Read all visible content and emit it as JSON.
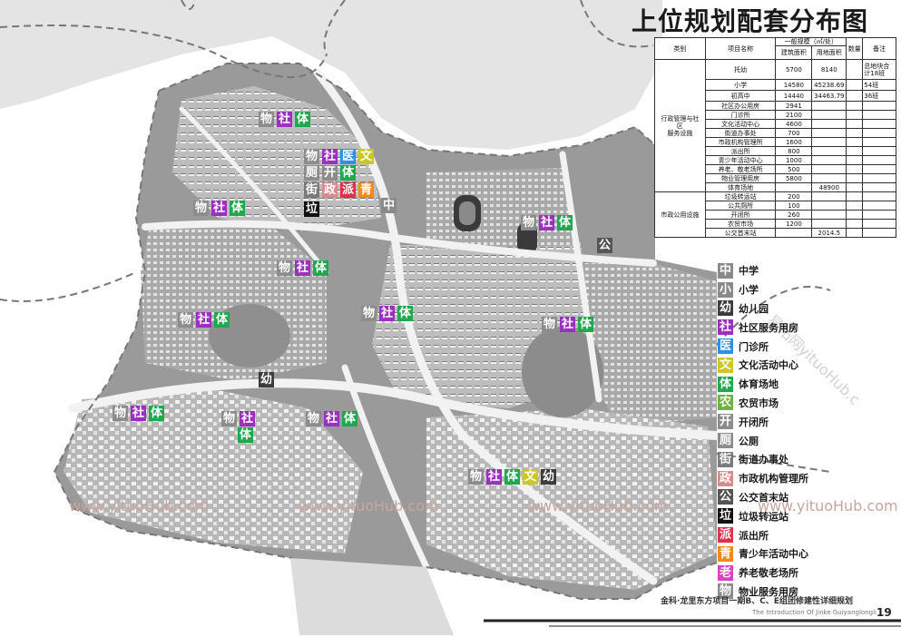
{
  "title": "上位规划配套分布图",
  "table": {
    "header": {
      "category": "类别",
      "item": "项目名称",
      "scale_group": "一般规模（㎡/处）",
      "build_area": "建筑面积",
      "land_area": "用地面积",
      "quantity": "数量",
      "note": "备注"
    },
    "groups": [
      {
        "name_lines": [
          "行政管理与社",
          "区",
          "服务设施"
        ]
      },
      {
        "name_lines": [
          "市政公用设施"
        ]
      }
    ],
    "rows": [
      {
        "name": "托幼",
        "build": "5700",
        "land": "8140",
        "qty": "",
        "note": "总地块合计18班"
      },
      {
        "name": "小学",
        "build": "14580",
        "land": "45238.69",
        "qty": "",
        "note": "54班"
      },
      {
        "name": "初高中",
        "build": "14440",
        "land": "34463.79",
        "qty": "",
        "note": "36班"
      },
      {
        "name": "社区办公用房",
        "build": "2941",
        "land": "",
        "qty": "",
        "note": ""
      },
      {
        "name": "门诊所",
        "build": "2100",
        "land": "",
        "qty": "",
        "note": ""
      },
      {
        "name": "文化活动中心",
        "build": "4600",
        "land": "",
        "qty": "",
        "note": ""
      },
      {
        "name": "街道办事处",
        "build": "700",
        "land": "",
        "qty": "",
        "note": ""
      },
      {
        "name": "市政机构管理所",
        "build": "1600",
        "land": "",
        "qty": "",
        "note": ""
      },
      {
        "name": "派出所",
        "build": "800",
        "land": "",
        "qty": "",
        "note": ""
      },
      {
        "name": "青少年活动中心",
        "build": "1000",
        "land": "",
        "qty": "",
        "note": ""
      },
      {
        "name": "养老、敬老场所",
        "build": "500",
        "land": "",
        "qty": "",
        "note": ""
      },
      {
        "name": "物业管理用房",
        "build": "5800",
        "land": "",
        "qty": "",
        "note": ""
      },
      {
        "name": "体育场地",
        "build": "",
        "land": "48900",
        "qty": "",
        "note": ""
      },
      {
        "name": "垃圾转运站",
        "build": "200",
        "land": "",
        "qty": "",
        "note": ""
      },
      {
        "name": "公共厕所",
        "build": "100",
        "land": "",
        "qty": "",
        "note": ""
      },
      {
        "name": "开闭所",
        "build": "260",
        "land": "",
        "qty": "",
        "note": ""
      },
      {
        "name": "农贸市场",
        "build": "1200",
        "land": "",
        "qty": "",
        "note": ""
      },
      {
        "name": "公交首末站",
        "build": "",
        "land": "2014.5",
        "qty": "",
        "note": ""
      }
    ]
  },
  "legend": [
    {
      "char": "中",
      "label": "中学",
      "color": "#8a8a8a"
    },
    {
      "char": "小",
      "label": "小学",
      "color": "#8a8a8a"
    },
    {
      "char": "幼",
      "label": "幼儿园",
      "color": "#3c3c3c"
    },
    {
      "char": "社",
      "label": "社区服务用房",
      "color": "#9b2fc0"
    },
    {
      "char": "医",
      "label": "门诊所",
      "color": "#2f8fe0"
    },
    {
      "char": "文",
      "label": "文化活动中心",
      "color": "#c9c91f"
    },
    {
      "char": "体",
      "label": "体育场地",
      "color": "#1fa84d"
    },
    {
      "char": "农",
      "label": "农贸市场",
      "color": "#6db33f"
    },
    {
      "char": "开",
      "label": "开闭所",
      "color": "#8c8c8c"
    },
    {
      "char": "厕",
      "label": "公厕",
      "color": "#8c8c8c"
    },
    {
      "char": "街",
      "label": "街道办事处",
      "color": "#7a7a7a"
    },
    {
      "char": "政",
      "label": "市政机构管理所",
      "color": "#d98a8a"
    },
    {
      "char": "公",
      "label": "公交首末站",
      "color": "#555555"
    },
    {
      "char": "垃",
      "label": "垃圾转运站",
      "color": "#111111"
    },
    {
      "char": "派",
      "label": "派出所",
      "color": "#e0304a"
    },
    {
      "char": "青",
      "label": "青少年活动中心",
      "color": "#f08a1a"
    },
    {
      "char": "老",
      "label": "养老敬老场所",
      "color": "#e040c0"
    },
    {
      "char": "物",
      "label": "物业服务用房",
      "color": "#8c8c8c"
    }
  ],
  "map_labels": [
    {
      "group": "物社体",
      "chars": [
        "物",
        "社",
        "体"
      ]
    },
    {
      "group": "物社医文",
      "chars": [
        "物",
        "社",
        "医",
        "文"
      ]
    },
    {
      "group": "厕开体",
      "chars": [
        "厕",
        "开",
        "体"
      ]
    },
    {
      "group": "街政派青",
      "chars": [
        "街",
        "政",
        "派",
        "青"
      ]
    },
    {
      "group": "物社体",
      "chars": [
        "物",
        "社",
        "体"
      ]
    },
    {
      "group": "垃",
      "chars": [
        "垃"
      ]
    },
    {
      "group": "中",
      "chars": [
        "中"
      ]
    },
    {
      "group": "物社体",
      "chars": [
        "物",
        "社",
        "体"
      ]
    },
    {
      "group": "公",
      "chars": [
        "公"
      ]
    },
    {
      "group": "物社体",
      "chars": [
        "物",
        "社",
        "体"
      ]
    },
    {
      "group": "物社体",
      "chars": [
        "物",
        "社",
        "体"
      ]
    },
    {
      "group": "物社体",
      "chars": [
        "物",
        "社",
        "体"
      ]
    },
    {
      "group": "物社体",
      "chars": [
        "物",
        "社",
        "体"
      ]
    },
    {
      "group": "幼",
      "chars": [
        "幼"
      ]
    },
    {
      "group": "物社体",
      "chars": [
        "物",
        "社",
        "体"
      ]
    },
    {
      "group": "物社",
      "chars": [
        "物",
        "社"
      ]
    },
    {
      "group": "体",
      "chars": [
        "体"
      ]
    },
    {
      "group": "物社体",
      "chars": [
        "物",
        "社",
        "体"
      ]
    },
    {
      "group": "物社体文幼",
      "chars": [
        "物",
        "社",
        "体",
        "文",
        "幼"
      ]
    }
  ],
  "watermarks": [
    "www.yituoHub.com",
    "www.yituoHub.com",
    "www.yituoHub.com",
    "www.yituoHub.com"
  ],
  "watermark_diag": "易拓网yituoHub.c",
  "footer": {
    "cn": "金科·龙里东方项目一期B、C、E组团修建性详细规划",
    "en": "The Introduction Of  Jinke Guiyanglongli",
    "page": "19"
  }
}
